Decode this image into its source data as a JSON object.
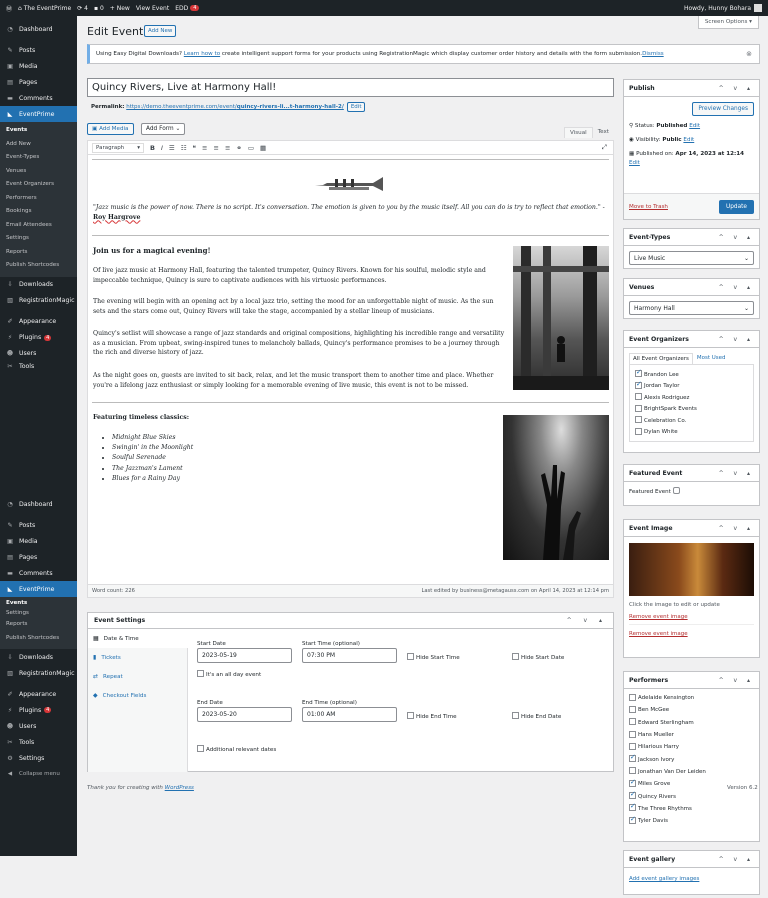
{
  "topbar": {
    "site": "The EventPrime",
    "updates": "4",
    "comments": "0",
    "new": "New",
    "view": "View Event",
    "edd": "EDD",
    "edd_count": "4",
    "howdy": "Howdy, Hunny Bohara"
  },
  "sidebar": {
    "items_top": [
      {
        "label": "Dashboard",
        "icon": "dashboard-icon"
      },
      {
        "label": "Posts",
        "icon": "pin-icon"
      },
      {
        "label": "Media",
        "icon": "media-icon"
      },
      {
        "label": "Pages",
        "icon": "pages-icon"
      },
      {
        "label": "Comments",
        "icon": "comments-icon"
      }
    ],
    "active": "EventPrime",
    "sub": [
      "Events",
      "Add New",
      "Event-Types",
      "Venues",
      "Event Organizers",
      "Performers",
      "Bookings",
      "Email Attendees",
      "Settings",
      "Reports",
      "Publish Shortcodes"
    ],
    "items_mid": [
      {
        "label": "Downloads"
      },
      {
        "label": "RegistrationMagic"
      }
    ],
    "items_bottom": [
      {
        "label": "Appearance"
      },
      {
        "label": "Plugins",
        "badge": "4"
      },
      {
        "label": "Users"
      },
      {
        "label": "Tools"
      }
    ],
    "items_top2": [
      "Dashboard",
      "Posts",
      "Media",
      "Pages",
      "Comments"
    ],
    "active2": "EventPrime",
    "sub2": [
      "Events",
      "Settings",
      "Reports",
      "Publish Shortcodes"
    ],
    "items_mid2": [
      "Downloads",
      "RegistrationMagic"
    ],
    "items_bottom2": [
      {
        "label": "Appearance"
      },
      {
        "label": "Plugins",
        "badge": "4"
      },
      {
        "label": "Users"
      },
      {
        "label": "Tools"
      },
      {
        "label": "Settings"
      },
      {
        "label": "Collapse menu"
      }
    ]
  },
  "header": {
    "title": "Edit Event",
    "add_new": "Add New",
    "screen_options": "Screen Options ▾"
  },
  "notice": {
    "text": "Using Easy Digital Downloads? ",
    "link": "Learn how to",
    "rest": " create intelligent support forms for your products using RegistrationMagic which display customer order history and details with the form submission.",
    "dismiss": "Dismiss"
  },
  "post": {
    "title": "Quincy Rivers, Live at Harmony Hall!",
    "permalink_label": "Permalink:",
    "permalink_start": "https://demo.theeventprime.com/event/",
    "permalink_slug": "quincy-rivers-li...t-harmony-hall-2/",
    "permalink_edit": "Edit"
  },
  "editor": {
    "add_media": "Add Media",
    "add_form": "Add Form",
    "tab_visual": "Visual",
    "tab_text": "Text",
    "format": "Paragraph",
    "quote": "\"Jazz music is the power of now. There is no script. It's conversation. The emotion is given to you by the music itself. All you can do is try to reflect that emotion.\" - ",
    "quote_by": "Roy Hargrove",
    "heading": "Join us for a magical evening!",
    "p1": "Of live jazz music at Harmony Hall, featuring the talented trumpeter, Quincy Rivers. Known for his soulful, melodic style and impeccable technique, Quincy is sure to captivate audiences with his virtuosic performances.",
    "p2": "The evening will begin with an opening act by a local jazz trio, setting the mood for an unforgettable night of music. As the sun sets and the stars come out, Quincy Rivers will take the stage, accompanied by a stellar lineup of musicians.",
    "p3": "Quincy's setlist will showcase a range of jazz standards and original compositions, highlighting his incredible range and versatility as a musician. From upbeat, swing-inspired tunes to melancholy ballads, Quincy's performance promises to be a journey through the rich and diverse history of jazz.",
    "p4": "As the night goes on, guests are invited to sit back, relax, and let the music transport them to another time and place. Whether you're a lifelong jazz enthusiast or simply looking for a memorable evening of live music, this event is not to be missed.",
    "featuring": "Featuring timeless classics:",
    "classics": [
      "Midnight Blue Skies",
      "Swingin' in the Moonlight",
      "Soulful Serenade",
      "The Jazzman's Lament",
      "Blues for a Rainy Day"
    ],
    "word_count": "Word count: 226",
    "last_edited": "Last edited by business@metagauss.com on April 14, 2023 at 12:14 pm"
  },
  "settings": {
    "title": "Event Settings",
    "tabs": [
      "Date & Time",
      "Tickets",
      "Repeat",
      "Checkout Fields"
    ],
    "start_date_label": "Start Date",
    "start_date": "2023-05-19",
    "start_time_label": "Start Time (optional)",
    "start_time": "07:30 PM",
    "hide_start_time": "Hide Start Time",
    "hide_start_date": "Hide Start Date",
    "all_day": "It's an all day event",
    "end_date_label": "End Date",
    "end_date": "2023-05-20",
    "end_time_label": "End Time (optional)",
    "end_time": "01:00 AM",
    "hide_end_time": "Hide End Time",
    "hide_end_date": "Hide End Date",
    "relevant": "Additional relevant dates"
  },
  "publish": {
    "title": "Publish",
    "preview": "Preview Changes",
    "status_label": "Status: ",
    "status": "Published",
    "visibility_label": "Visibility: ",
    "visibility": "Public",
    "published_on_label": "Published on: ",
    "published_on": "Apr 14, 2023 at 12:14",
    "edit": "Edit",
    "trash": "Move to Trash",
    "update": "Update"
  },
  "event_types": {
    "title": "Event-Types",
    "value": "Live Music"
  },
  "venues": {
    "title": "Venues",
    "value": "Harmony Hall"
  },
  "organizers": {
    "title": "Event Organizers",
    "tab_all": "All Event Organizers",
    "tab_used": "Most Used",
    "items": [
      {
        "name": "Brandon Lee",
        "checked": true
      },
      {
        "name": "Jordan Taylor",
        "checked": true
      },
      {
        "name": "Alexis Rodriguez",
        "checked": false
      },
      {
        "name": "BrightSpark Events",
        "checked": false
      },
      {
        "name": "Celebration Co.",
        "checked": false
      },
      {
        "name": "Dylan White",
        "checked": false
      }
    ]
  },
  "featured": {
    "title": "Featured Event",
    "label": "Featured Event"
  },
  "event_image": {
    "title": "Event Image",
    "hint": "Click the image to edit or update",
    "remove": "Remove event image"
  },
  "performers": {
    "title": "Performers",
    "items": [
      {
        "name": "Adelaide Kensington",
        "checked": false
      },
      {
        "name": "Ben McGee",
        "checked": false
      },
      {
        "name": "Edward Sterlingham",
        "checked": false
      },
      {
        "name": "Hans Mueller",
        "checked": false
      },
      {
        "name": "Hilarious Harry",
        "checked": false
      },
      {
        "name": "Jackson Ivory",
        "checked": true
      },
      {
        "name": "Jonathan Van Der Leiden",
        "checked": false
      },
      {
        "name": "Miles Grove",
        "checked": true
      },
      {
        "name": "Quincy Rivers",
        "checked": true
      },
      {
        "name": "The Three Rhythms",
        "checked": true
      },
      {
        "name": "Tyler Davis",
        "checked": true
      }
    ]
  },
  "gallery": {
    "title": "Event gallery",
    "add": "Add event gallery images"
  },
  "footer": {
    "thanks": "Thank you for creating with ",
    "wp": "WordPress",
    "version": "Version 6.2"
  }
}
